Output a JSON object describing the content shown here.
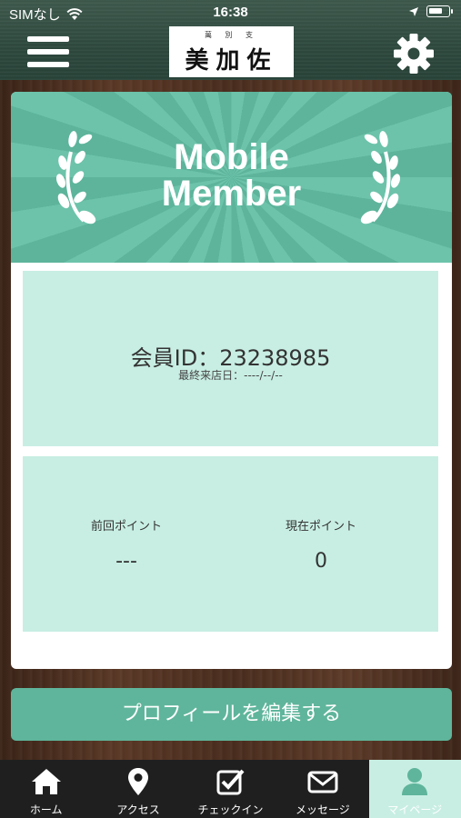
{
  "status_bar": {
    "carrier": "SIMなし",
    "time": "16:38",
    "battery_level": 0.75
  },
  "header": {
    "logo_small": "萬 別 支",
    "logo_main": "美加佐",
    "menu_icon": "hamburger-menu-icon",
    "settings_icon": "gear-icon"
  },
  "card": {
    "banner_title_line1": "Mobile",
    "banner_title_line2": "Member",
    "member_id": "会員ID：23238985",
    "last_visit": "最終来店日：----/--/--",
    "points": {
      "previous_label": "前回ポイント",
      "previous_value": "---",
      "current_label": "現在ポイント",
      "current_value": "0"
    }
  },
  "edit_profile_button": "プロフィールを編集する",
  "tabs": [
    {
      "label": "ホーム",
      "icon": "home-icon"
    },
    {
      "label": "アクセス",
      "icon": "map-pin-icon"
    },
    {
      "label": "チェックイン",
      "icon": "checkbox-icon"
    },
    {
      "label": "メッセージ",
      "icon": "mail-icon"
    },
    {
      "label": "マイページ",
      "icon": "user-icon",
      "active": true
    }
  ],
  "colors": {
    "accent": "#5fb59b",
    "panel": "#c8eee3",
    "header": "#2f4a3f",
    "tabbar": "#1f1f1f"
  }
}
